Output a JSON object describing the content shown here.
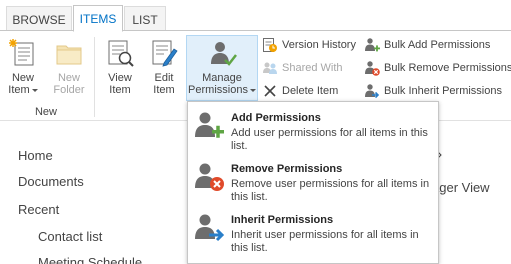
{
  "tabs": [
    {
      "label": "BROWSE"
    },
    {
      "label": "ITEMS"
    },
    {
      "label": "LIST"
    }
  ],
  "ribbon": {
    "new_item": "New Item",
    "new_folder_line1": "New",
    "new_folder_line2": "Folder",
    "new_group_label": "New",
    "view_item_line1": "View",
    "view_item_line2": "Item",
    "edit_item_line1": "Edit",
    "edit_item_line2": "Item",
    "manage_line1": "Manage",
    "manage_line2": "Permissions",
    "version_history": "Version History",
    "shared_with": "Shared With",
    "delete_item": "Delete Item",
    "bulk_add": "Bulk Add Permissions",
    "bulk_remove": "Bulk Remove Permissions",
    "bulk_inherit": "Bulk Inherit Permissions"
  },
  "menu": {
    "add_title": "Add Permissions",
    "add_desc": "Add user permissions for all items in this list.",
    "remove_title": "Remove Permissions",
    "remove_desc": "Remove user permissions for all items in this list.",
    "inherit_title": "Inherit Permissions",
    "inherit_desc": "Inherit user permissions for all items in this list."
  },
  "nav": {
    "home": "Home",
    "documents": "Documents",
    "recent": "Recent",
    "contact_list": "Contact list",
    "meeting_schedule": "Meeting Schedule"
  },
  "background": {
    "fragment": "ager View"
  },
  "colors": {
    "accent": "#0072c6",
    "add_green": "#5fa544",
    "remove_red": "#e04a2a",
    "inherit_blue": "#2a7fc9",
    "person_gray": "#6d6d6d"
  },
  "icons": {
    "new_item": "new-item-icon",
    "new_folder": "folder-icon",
    "view_item": "view-item-icon",
    "edit_item": "edit-item-icon",
    "manage": "manage-permissions-icon",
    "version": "version-history-icon",
    "shared": "shared-with-icon",
    "delete": "delete-x-icon",
    "bulk_add": "bulk-add-icon",
    "bulk_remove": "bulk-remove-icon",
    "bulk_inherit": "bulk-inherit-icon"
  }
}
